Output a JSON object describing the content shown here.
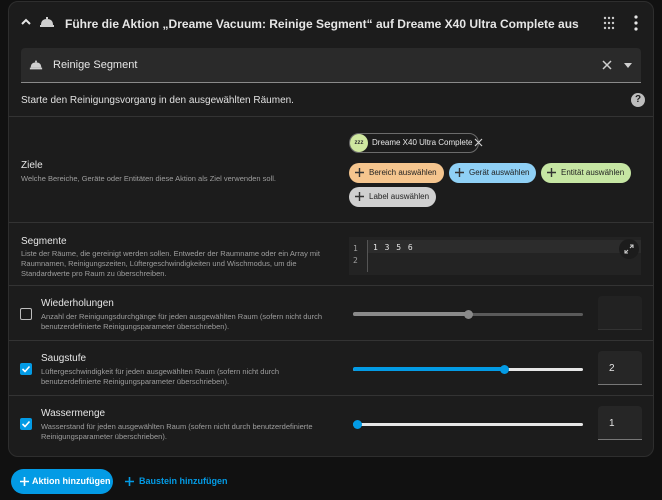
{
  "header": {
    "title": "Führe die Aktion „Dreame Vacuum: Reinige Segment“ auf Dreame X40 Ultra Complete aus",
    "icons": [
      "chevron-up-icon",
      "vacuum-icon",
      "drag-handle-icon",
      "more-vert-icon"
    ]
  },
  "action_select": {
    "value": "Reinige Segment"
  },
  "description": "Starte den Reinigungsvorgang in den ausgewählten Räumen.",
  "targets": {
    "label": "Ziele",
    "description": "Welche Bereiche, Geräte oder Entitäten diese Aktion als Ziel verwenden soll.",
    "entity_chip": {
      "icon_text": "zzz",
      "label": "Dreame X40 Ultra Complete"
    },
    "buttons": {
      "area": "Bereich auswählen",
      "device": "Gerät auswählen",
      "entity": "Entität auswählen",
      "label": "Label auswählen"
    },
    "colors": {
      "area": "#f5c58e",
      "device": "#8fd0f5",
      "entity": "#c6e6a3",
      "label": "#d0d0d0"
    }
  },
  "segments": {
    "label": "Segmente",
    "description": "Liste der Räume, die gereinigt werden sollen. Entweder der Raumname oder ein Array mit Raumnamen, Reinigungszeiten, Lüftergeschwindigkeiten und Wischmodus, um die Standardwerte pro Raum zu überschreiben.",
    "line_numbers": [
      "1",
      "2"
    ],
    "code": "1 3 5 6"
  },
  "repeats": {
    "label": "Wiederholungen",
    "description": "Anzahl der Reinigungsdurchgänge für jeden ausgewählten Raum (sofern nicht durch benutzerdefinierte Reinigungsparameter überschrieben).",
    "enabled": false,
    "slider_fraction": 0.5,
    "value": ""
  },
  "suction": {
    "label": "Saugstufe",
    "description": "Lüftergeschwindigkeit für jeden ausgewählten Raum (sofern nicht durch benutzerdefinierte Reinigungsparameter überschrieben).",
    "enabled": true,
    "slider_fraction": 0.667,
    "value": "2"
  },
  "water": {
    "label": "Wassermenge",
    "description": "Wasserstand für jeden ausgewählten Raum (sofern nicht durch benutzerdefinierte Reinigungsparameter überschrieben).",
    "enabled": true,
    "slider_fraction": 0.0,
    "value": "1"
  },
  "footer": {
    "add_action": "Aktion hinzufügen",
    "add_block": "Baustein hinzufügen"
  },
  "accent_color": "#039be5"
}
